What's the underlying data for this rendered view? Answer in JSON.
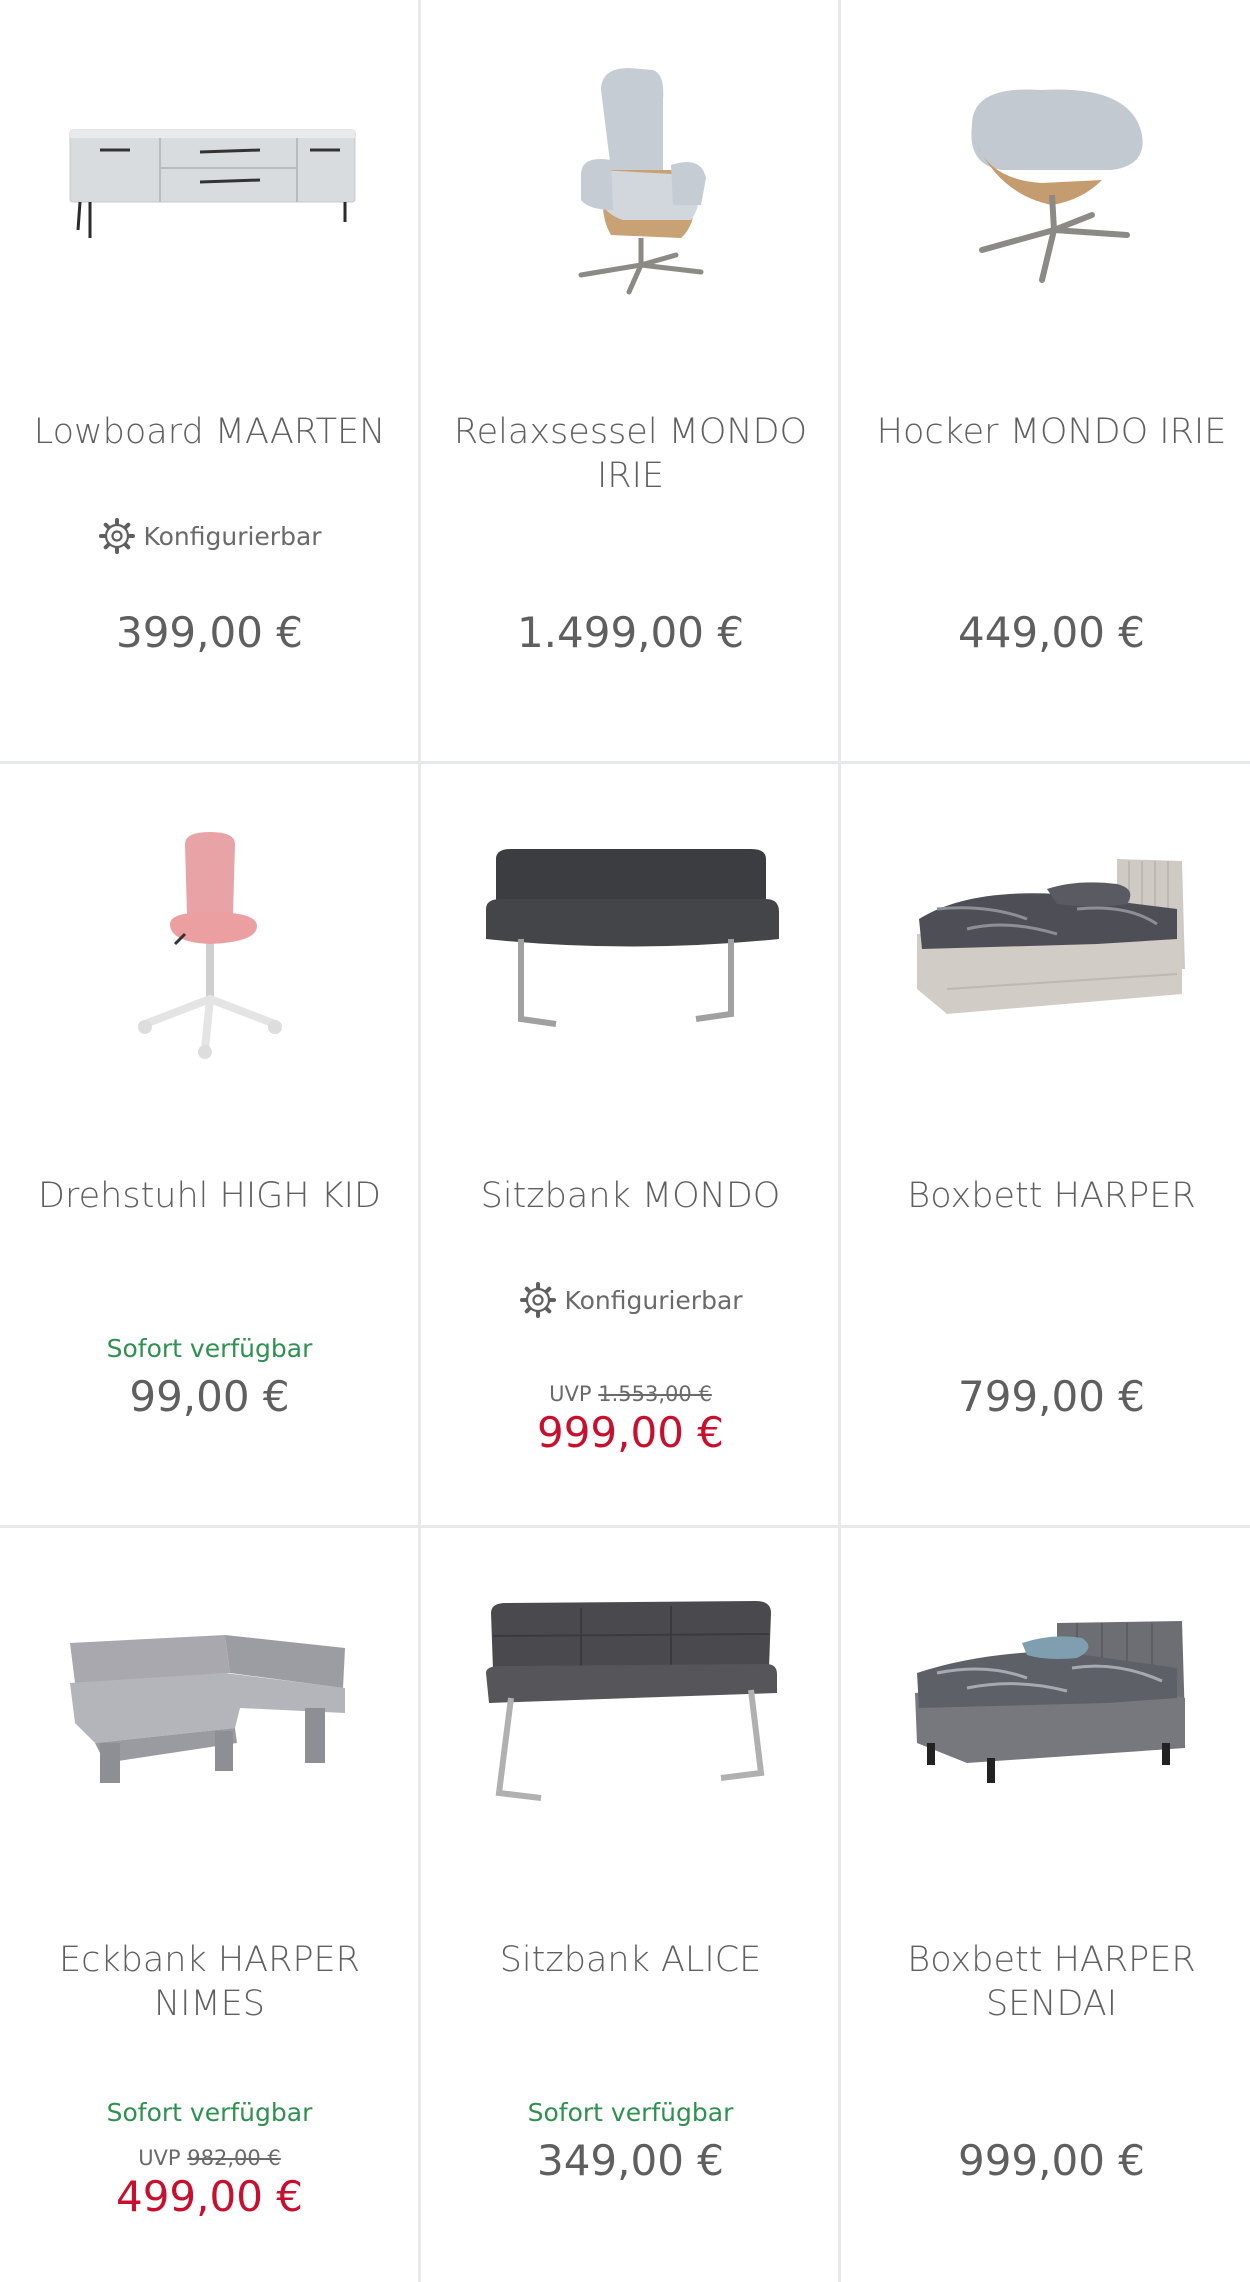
{
  "products": [
    {
      "title": "Lowboard MAARTEN",
      "config": "Konfigurierbar",
      "price": "399,00 €"
    },
    {
      "title": "Relaxsessel MONDO IRIE",
      "price": "1.499,00 €"
    },
    {
      "title": "Hocker MONDO IRIE",
      "price": "449,00 €"
    },
    {
      "title": "Drehstuhl HIGH KID",
      "availability": "Sofort verfügbar",
      "price": "99,00 €"
    },
    {
      "title": "Sitzbank MONDO",
      "config": "Konfigurierbar",
      "uvp_label": "UVP",
      "uvp_price": "1.553,00 €",
      "price": "999,00 €"
    },
    {
      "title": "Boxbett HARPER",
      "price": "799,00 €"
    },
    {
      "title": "Eckbank HARPER NIMES",
      "availability": "Sofort verfügbar",
      "uvp_label": "UVP",
      "uvp_price": "982,00 €",
      "price": "499,00 €"
    },
    {
      "title": "Sitzbank ALICE",
      "availability": "Sofort verfügbar",
      "price": "349,00 €"
    },
    {
      "title": "Boxbett HARPER SENDAI",
      "price": "999,00 €"
    }
  ],
  "colors": {
    "sale": "#c8102e",
    "availability": "#2e9150",
    "divider": "#e6e8ea"
  },
  "icons": {
    "config": "gear-icon"
  }
}
